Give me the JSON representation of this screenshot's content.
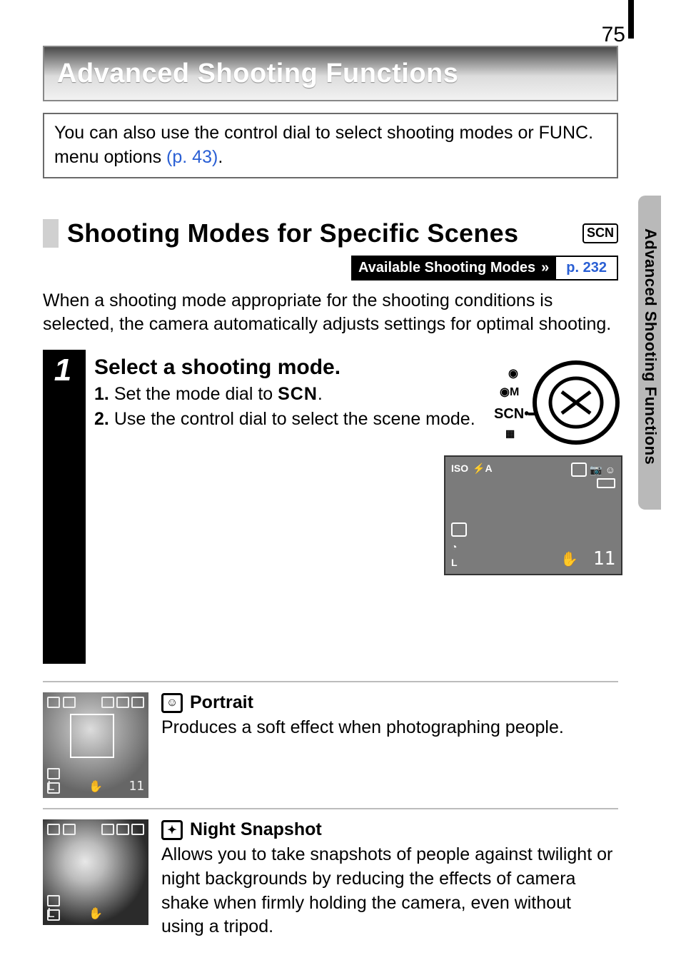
{
  "page_number": "75",
  "sidebar_label": "Advanced Shooting Functions",
  "chapter_title": "Advanced Shooting Functions",
  "intro": {
    "text_before_link": "You can also use the control dial to select shooting modes or FUNC. menu options ",
    "link": "(p. 43)",
    "text_after_link": "."
  },
  "section": {
    "title": "Shooting Modes for Specific Scenes",
    "scn_badge": "SCN",
    "modes_label": "Available Shooting Modes",
    "modes_page_ref": "p. 232",
    "paragraph": "When a shooting mode appropriate for the shooting conditions is selected, the camera automatically adjusts settings for optimal shooting."
  },
  "step": {
    "number": "1",
    "title": "Select a shooting mode.",
    "sub1_prefix": "1.",
    "sub1_text_a": "Set the mode dial to ",
    "sub1_scn": "SCN",
    "sub1_text_b": ".",
    "sub2_prefix": "2.",
    "sub2_text": "Use the control dial to select the scene mode.",
    "lcd_count": "11",
    "lcd_iso": "ISO",
    "lcd_l": "L"
  },
  "modes": [
    {
      "icon_glyph": "☺",
      "title": "Portrait",
      "description": "Produces a soft effect when photographing people.",
      "thumb_l": "L",
      "thumb_11": "11"
    },
    {
      "icon_glyph": "✦",
      "title": "Night Snapshot",
      "description": "Allows you to take snapshots of people against twilight or night backgrounds by reducing the effects of camera shake when firmly holding the camera, even without using a tripod.",
      "thumb_l": "L"
    }
  ]
}
